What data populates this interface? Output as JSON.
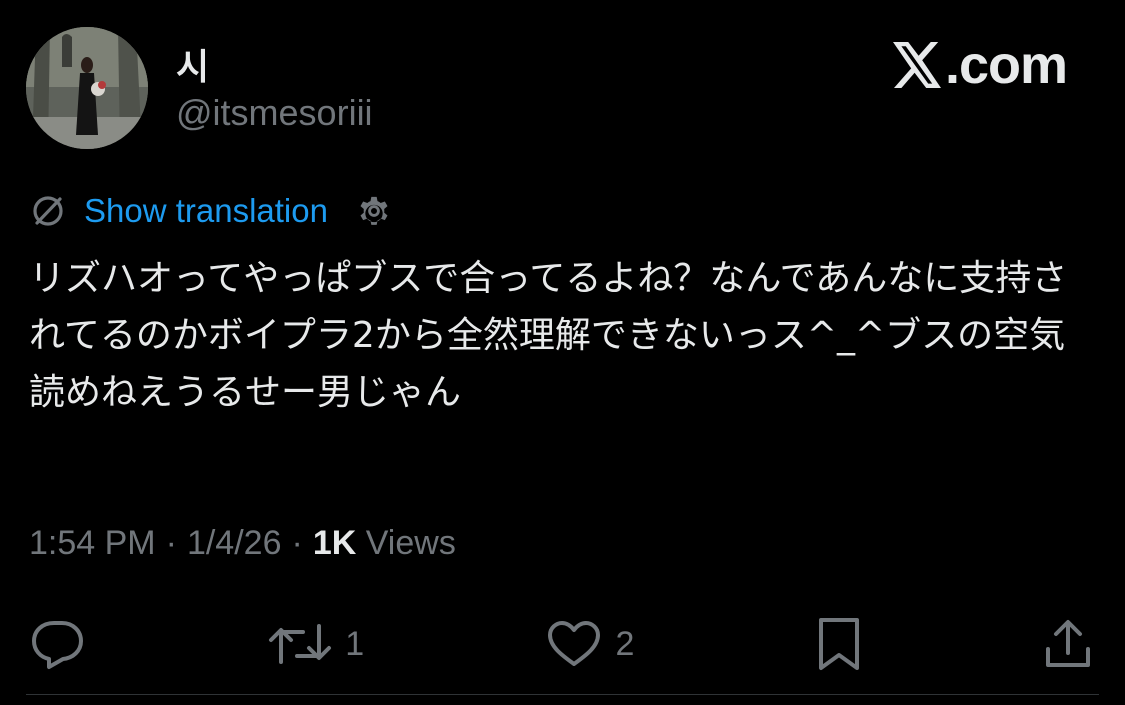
{
  "author": {
    "display_name": "시",
    "handle": "@itsmesoriii"
  },
  "brand": {
    "label": ".com",
    "icon": "x-logo-icon"
  },
  "translation": {
    "label": "Show translation",
    "icon": "translate-icon",
    "settings_icon": "gear-icon"
  },
  "tweet": {
    "text": "リズハオってやっぱブスで合ってるよね？なんであんなに支持されてるのかボイプラ2から全然理解できないっス^_^ブスの空気読めねえうるせー男じゃん"
  },
  "meta": {
    "time": "1:54 PM",
    "separator": "·",
    "date": "1/4/26",
    "views_count": "1K",
    "views_label": "Views"
  },
  "actions": {
    "reply_icon": "reply-icon",
    "retweet_count": "1",
    "like_count": "2",
    "bookmark_icon": "bookmark-icon",
    "share_icon": "share-icon"
  },
  "colors": {
    "background": "#000000",
    "text": "#e7e9ea",
    "muted": "#71767b",
    "link": "#1d9bf0"
  }
}
